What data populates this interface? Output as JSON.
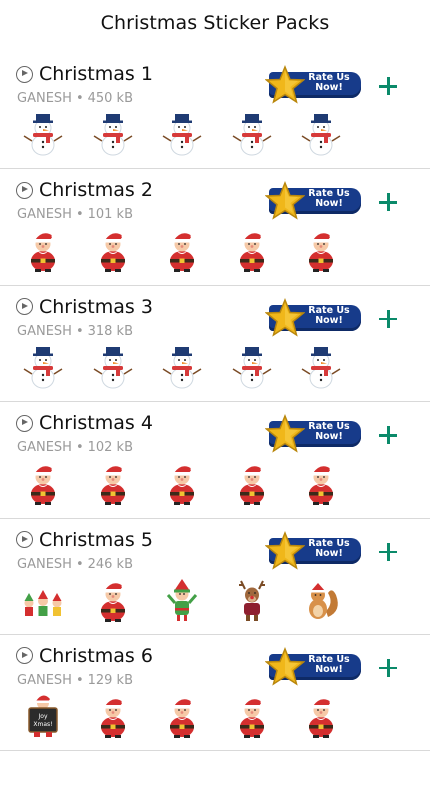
{
  "header": {
    "title": "Christmas Sticker Packs"
  },
  "rate_button": {
    "label": "Rate Us\nNow!"
  },
  "colors": {
    "accent": "#0b8a6a",
    "ribbon": "#173b8a",
    "star": "#f0b71a"
  },
  "packs": [
    {
      "name": "Christmas 1",
      "author": "GANESH",
      "size": "450 kB",
      "stickers": [
        "snowman-icon",
        "snowman-icon",
        "snowman-icon",
        "snowman-icon",
        "snowman-icon"
      ]
    },
    {
      "name": "Christmas 2",
      "author": "GANESH",
      "size": "101 kB",
      "stickers": [
        "santa-icon",
        "santa-icon",
        "santa-icon",
        "santa-icon",
        "santa-icon"
      ]
    },
    {
      "name": "Christmas 3",
      "author": "GANESH",
      "size": "318 kB",
      "stickers": [
        "snowman-icon",
        "snowman-icon",
        "snowman-icon",
        "snowman-icon",
        "snowman-icon"
      ]
    },
    {
      "name": "Christmas 4",
      "author": "GANESH",
      "size": "102 kB",
      "stickers": [
        "santa-icon",
        "santa-icon",
        "santa-icon",
        "santa-icon",
        "santa-icon"
      ]
    },
    {
      "name": "Christmas 5",
      "author": "GANESH",
      "size": "246 kB",
      "stickers": [
        "elves-icon",
        "santa-icon",
        "elf-icon",
        "reindeer-icon",
        "squirrel-icon"
      ]
    },
    {
      "name": "Christmas 6",
      "author": "GANESH",
      "size": "129 kB",
      "stickers": [
        "sign-icon",
        "santa-icon",
        "santa-icon",
        "santa-icon",
        "santa-icon"
      ],
      "sign_text": "Joy\nXmas!"
    }
  ]
}
